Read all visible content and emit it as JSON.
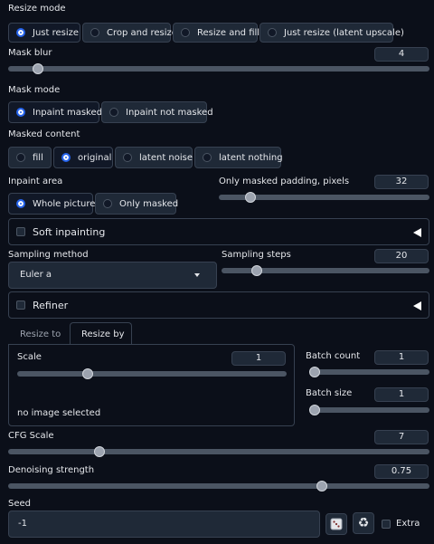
{
  "resize_mode": {
    "label": "Resize mode",
    "options": [
      "Just resize",
      "Crop and resize",
      "Resize and fill",
      "Just resize (latent upscale)"
    ],
    "selected": "Just resize"
  },
  "mask_blur": {
    "label": "Mask blur",
    "value": "4",
    "fraction": 0.06
  },
  "mask_mode": {
    "label": "Mask mode",
    "options": [
      "Inpaint masked",
      "Inpaint not masked"
    ],
    "selected": "Inpaint masked"
  },
  "masked_content": {
    "label": "Masked content",
    "options": [
      "fill",
      "original",
      "latent noise",
      "latent nothing"
    ],
    "selected": "original"
  },
  "inpaint_area": {
    "label": "Inpaint area",
    "options": [
      "Whole picture",
      "Only masked"
    ],
    "selected": "Whole picture"
  },
  "only_masked_padding": {
    "label": "Only masked padding, pixels",
    "value": "32",
    "fraction": 0.13
  },
  "soft_inpainting": {
    "label": "Soft inpainting"
  },
  "sampling_method": {
    "label": "Sampling method",
    "value": "Euler a"
  },
  "sampling_steps": {
    "label": "Sampling steps",
    "value": "20",
    "fraction": 0.15
  },
  "refiner": {
    "label": "Refiner"
  },
  "resize_tabs": {
    "tabs": [
      "Resize to",
      "Resize by"
    ],
    "selected": "Resize by"
  },
  "scale": {
    "label": "Scale",
    "value": "1",
    "fraction": 0.25,
    "note": "no image selected"
  },
  "batch_count": {
    "label": "Batch count",
    "value": "1",
    "fraction": 0.0
  },
  "batch_size": {
    "label": "Batch size",
    "value": "1",
    "fraction": 0.0
  },
  "cfg_scale": {
    "label": "CFG Scale",
    "value": "7",
    "fraction": 0.21
  },
  "denoising": {
    "label": "Denoising strength",
    "value": "0.75",
    "fraction": 0.75
  },
  "seed": {
    "label": "Seed",
    "value": "-1",
    "extra_label": "Extra"
  },
  "colors": {
    "background": "#0b0f19",
    "panel": "#1f2937",
    "border": "#374151",
    "accent": "#2563eb"
  }
}
